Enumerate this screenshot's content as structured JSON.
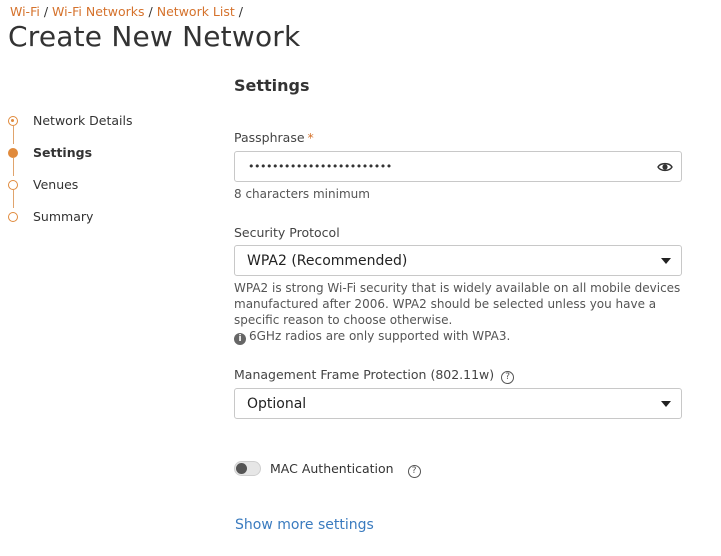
{
  "breadcrumb": {
    "items": [
      "Wi-Fi",
      "Wi-Fi Networks",
      "Network List"
    ],
    "separator": "/"
  },
  "page": {
    "title": "Create New Network"
  },
  "steps": [
    {
      "label": "Network Details",
      "state": "done"
    },
    {
      "label": "Settings",
      "state": "active"
    },
    {
      "label": "Venues",
      "state": "pending"
    },
    {
      "label": "Summary",
      "state": "pending"
    }
  ],
  "settings": {
    "title": "Settings",
    "passphrase": {
      "label": "Passphrase",
      "required_marker": "*",
      "value": "••••••••••••••••••••••••",
      "hint": "8 characters minimum",
      "toggle_icon": "eye-icon"
    },
    "security_protocol": {
      "label": "Security Protocol",
      "value": "WPA2 (Recommended)",
      "description": "WPA2 is strong Wi-Fi security that is widely available on all mobile devices manufactured after 2006. WPA2 should be selected unless you have a specific reason to choose otherwise.",
      "info_glyph": "i",
      "note": "6GHz radios are only supported with WPA3."
    },
    "mgmt_frame_protection": {
      "label": "Management Frame Protection (802.11w)",
      "help_glyph": "?",
      "value": "Optional"
    },
    "mac_auth": {
      "label": "MAC Authentication",
      "help_glyph": "?",
      "enabled": false
    },
    "show_more": "Show more settings"
  },
  "colors": {
    "accent": "#e08a3c",
    "link_orange": "#d5722c",
    "link_blue": "#3a7bbf"
  }
}
